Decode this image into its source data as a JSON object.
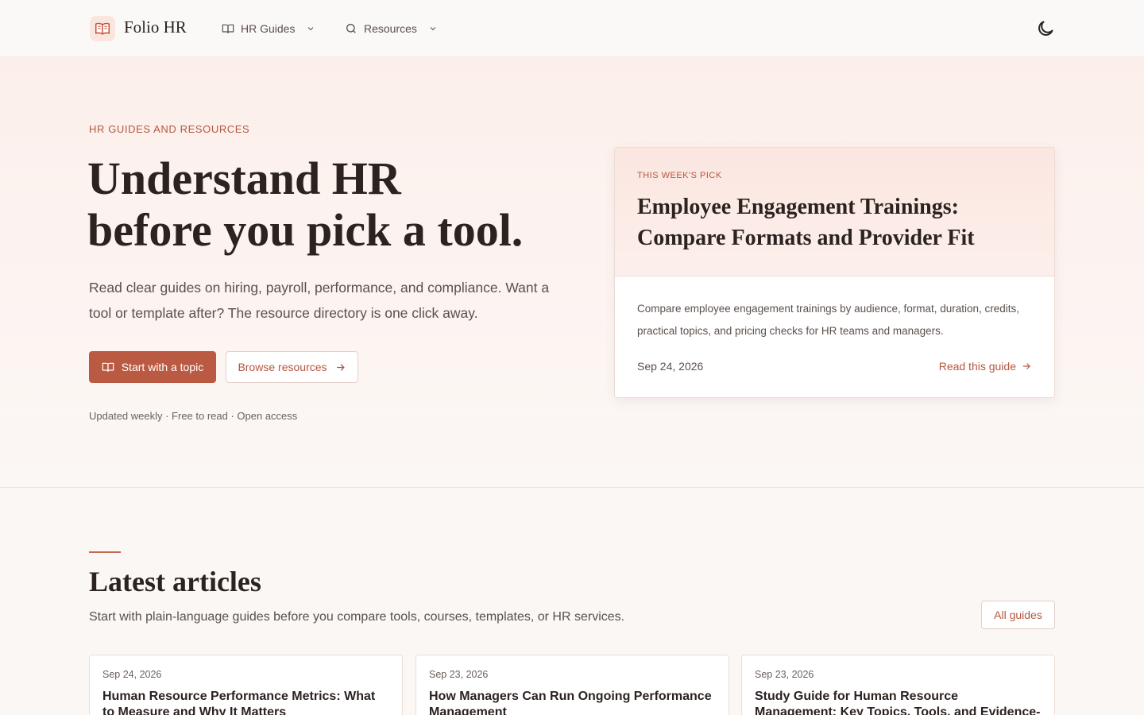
{
  "header": {
    "brand": "Folio HR",
    "logo_icon": "open-book-icon",
    "nav": [
      {
        "label": "HR Guides",
        "icon": "book-icon"
      },
      {
        "label": "Resources",
        "icon": "search-icon"
      }
    ],
    "theme_icon": "moon-icon"
  },
  "hero": {
    "eyebrow": "HR GUIDES AND RESOURCES",
    "title_line1": "Understand HR",
    "title_line2": "before you pick a tool.",
    "description": "Read clear guides on hiring, payroll, performance, and compliance. Want a tool or template after? The resource directory is one click away.",
    "primary_button": "Start with a topic",
    "secondary_button": "Browse resources",
    "meta": "Updated weekly · Free to read · Open access"
  },
  "pick": {
    "eyebrow": "THIS WEEK'S PICK",
    "title": "Employee Engagement Trainings: Compare Formats and Provider Fit",
    "description": "Compare employee engagement trainings by audience, format, duration, credits, practical topics, and pricing checks for HR teams and managers.",
    "date": "Sep 24, 2026",
    "link": "Read this guide"
  },
  "latest": {
    "title": "Latest articles",
    "description": "Start with plain-language guides before you compare tools, courses, templates, or HR services.",
    "all_button": "All guides",
    "articles": [
      {
        "date": "Sep 24, 2026",
        "title": "Human Resource Performance Metrics: What to Measure and Why It Matters"
      },
      {
        "date": "Sep 23, 2026",
        "title": "How Managers Can Run Ongoing Performance Management"
      },
      {
        "date": "Sep 23, 2026",
        "title": "Study Guide for Human Resource Management: Key Topics, Tools, and Evidence-Based Practices"
      }
    ]
  },
  "colors": {
    "accent": "#bb5a42",
    "accent_text": "#b5573f",
    "hero_bg": "#fcefeb"
  }
}
